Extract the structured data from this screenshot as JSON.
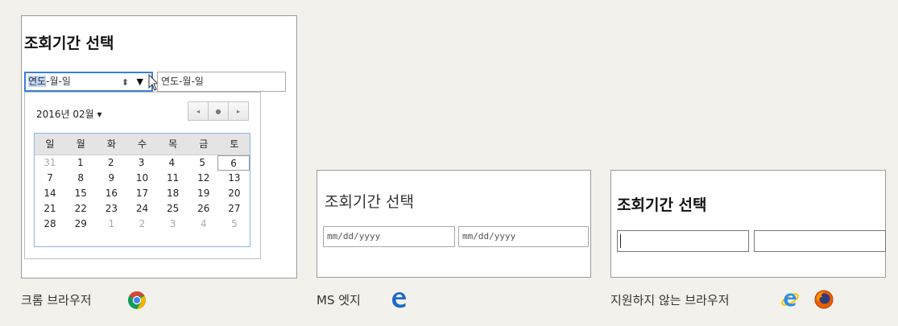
{
  "chrome": {
    "title": "조회기간 선택",
    "start_field": {
      "seg1": "연도",
      "sep1": "-",
      "seg2": "월",
      "sep2": "-",
      "seg3": "일",
      "spinner": "⬍",
      "dropdown": "▼"
    },
    "end_field": {
      "value": "연도-월-일"
    },
    "calendar": {
      "month_label": "2016년 02월",
      "month_caret": "▾",
      "nav": {
        "prev": "◂",
        "today": "●",
        "next": "▸"
      },
      "weekdays": [
        "일",
        "월",
        "화",
        "수",
        "목",
        "금",
        "토"
      ],
      "rows": [
        [
          "31",
          "1",
          "2",
          "3",
          "4",
          "5",
          "6"
        ],
        [
          "7",
          "8",
          "9",
          "10",
          "11",
          "12",
          "13"
        ],
        [
          "14",
          "15",
          "16",
          "17",
          "18",
          "19",
          "20"
        ],
        [
          "21",
          "22",
          "23",
          "24",
          "25",
          "26",
          "27"
        ],
        [
          "28",
          "29",
          "1",
          "2",
          "3",
          "4",
          "5"
        ]
      ]
    },
    "caption": "크롬 브라우저",
    "icon": "chrome-logo-icon"
  },
  "edge": {
    "title": "조회기간 선택",
    "start_placeholder": "mm/dd/yyyy",
    "end_placeholder": "mm/dd/yyyy",
    "caption": "MS 엣지",
    "icon": "edge-logo-icon"
  },
  "unsupported": {
    "title": "조회기간 선택",
    "caption": "지원하지 않는 브라우저",
    "icons": [
      "internet-explorer-logo-icon",
      "firefox-logo-icon"
    ]
  },
  "colors": {
    "background": "#f3f1ec",
    "focus_border": "#3c7fd6",
    "edge_blue": "#1b6ac9",
    "chrome_red": "#db4437",
    "chrome_yellow": "#f4b400",
    "chrome_green": "#0f9d58",
    "firefox_orange": "#e66000"
  }
}
